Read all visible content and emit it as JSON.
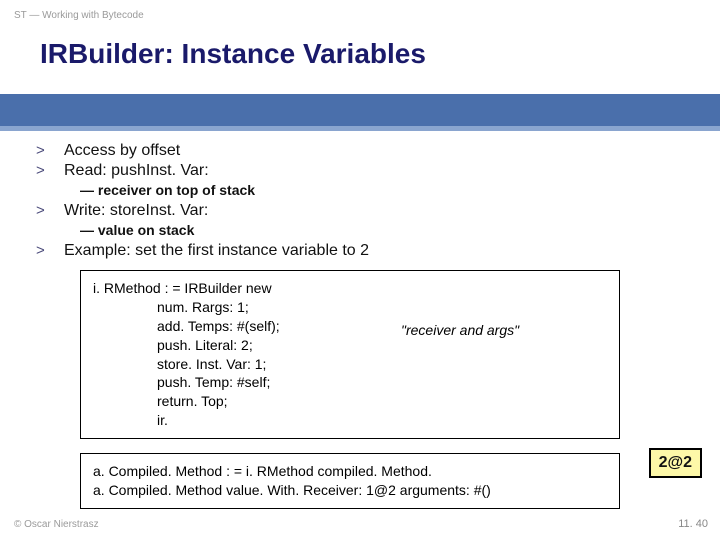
{
  "header_label": "ST — Working with Bytecode",
  "title": "IRBuilder: Instance Variables",
  "items": {
    "b1": "Access by offset",
    "b2": "Read: pushInst. Var:",
    "s2": "—  receiver on top of stack",
    "b3": "Write: storeInst. Var:",
    "s3": "—  value on stack",
    "b4": "Example: set the first instance variable to 2"
  },
  "bullet": ">",
  "code1": {
    "l0": "i. RMethod : = IRBuilder new",
    "l1": "num. Rargs: 1;",
    "l2": "add. Temps: #(self);",
    "l3": "push. Literal: 2;",
    "l4": "store. Inst. Var: 1;",
    "l5": "push. Temp: #self;",
    "l6": "return. Top;",
    "l7": "ir.",
    "note": "\"receiver and args\""
  },
  "code2": {
    "l0": "a. Compiled. Method : = i. RMethod compiled. Method.",
    "l1": "a. Compiled. Method value. With. Receiver: 1@2 arguments: #()"
  },
  "badge": "2@2",
  "footer_left": "© Oscar Nierstrasz",
  "footer_right": "11. 40"
}
